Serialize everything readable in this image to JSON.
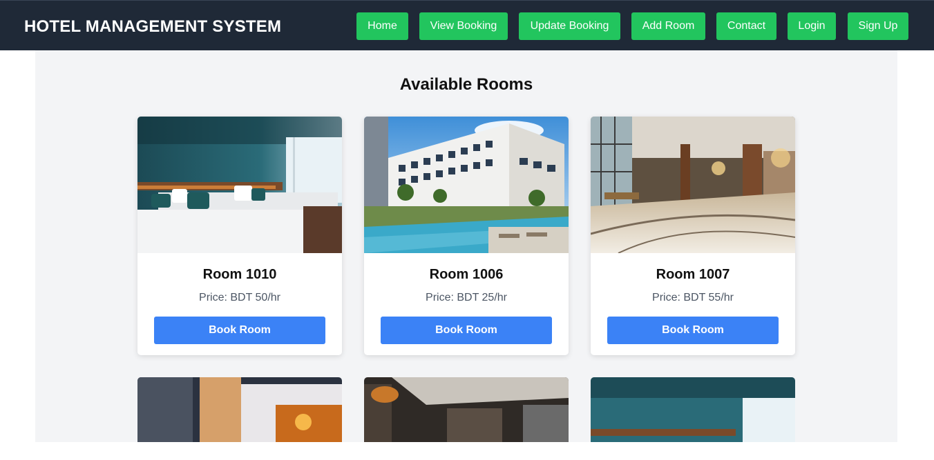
{
  "header": {
    "brand": "HOTEL MANAGEMENT SYSTEM",
    "nav": [
      "Home",
      "View Booking",
      "Update Booking",
      "Add Room",
      "Contact",
      "Login",
      "Sign Up"
    ],
    "nav_color": "#22c55e",
    "background": "#1f2937"
  },
  "main": {
    "title": "Available Rooms",
    "book_label": "Book Room",
    "book_color": "#3b82f6",
    "rooms": [
      {
        "name": "Room 1010",
        "price": "Price: BDT 50/hr",
        "image": "bedroom-photo"
      },
      {
        "name": "Room 1006",
        "price": "Price: BDT 25/hr",
        "image": "hotel-pool-photo"
      },
      {
        "name": "Room 1007",
        "price": "Price: BDT 55/hr",
        "image": "lobby-photo"
      }
    ],
    "more_rooms_images": [
      "city-night-photo",
      "dark-interior-photo",
      "bedroom-photo"
    ]
  }
}
